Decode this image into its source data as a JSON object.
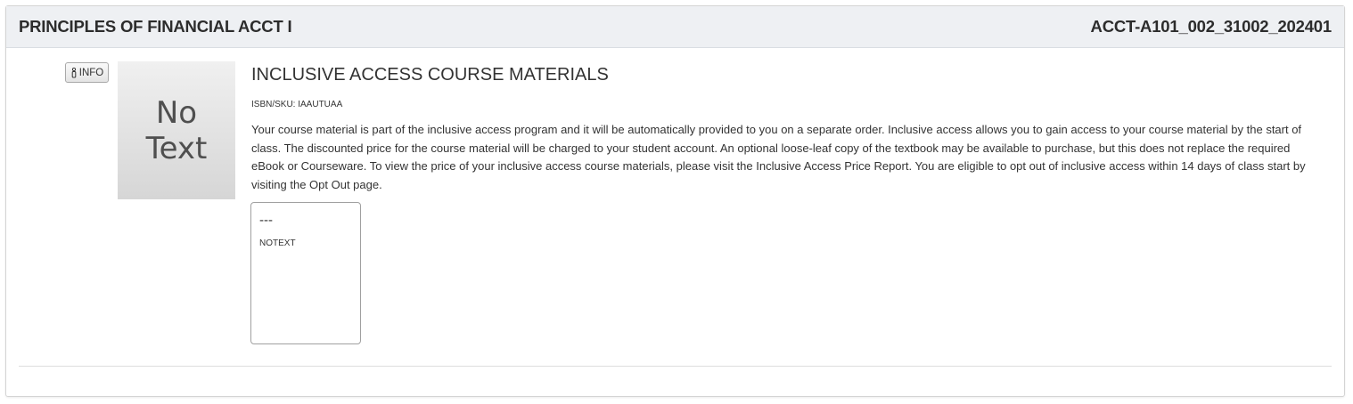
{
  "header": {
    "course_name": "PRINCIPLES OF FINANCIAL ACCT I",
    "course_code": "ACCT-A101_002_31002_202401"
  },
  "info_button": {
    "label": "INFO",
    "icon": "info-icon"
  },
  "cover": {
    "line1": "No",
    "line2": "Text"
  },
  "material": {
    "title": "INCLUSIVE ACCESS COURSE MATERIALS",
    "isbn": "ISBN/SKU: IAAUTUAA",
    "description": "Your course material is part of the inclusive access program and it will be automatically provided to you on a separate order. Inclusive access allows you to gain access to your course material by the start of class. The discounted price for the course material will be charged to your student account. An optional loose-leaf copy of the textbook may be available to purchase, but this does not replace the required eBook or Courseware. To view the price of your inclusive access course materials, please visit the Inclusive Access Price Report. You are eligible to opt out of inclusive access within 14 days of class start by visiting the Opt Out page."
  },
  "option": {
    "price": "---",
    "label": "NOTEXT"
  }
}
